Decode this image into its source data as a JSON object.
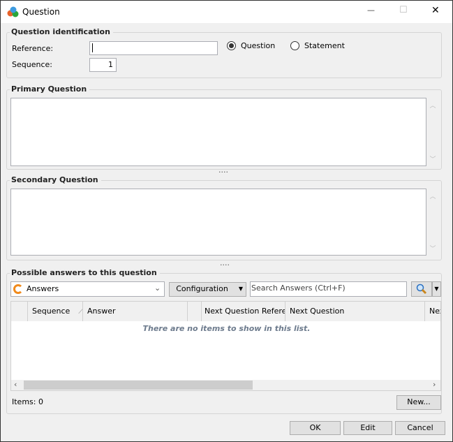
{
  "window": {
    "title": "Question",
    "minimize": "—",
    "maximize": "☐",
    "close": "✕"
  },
  "identification": {
    "title": "Question identification",
    "reference_label": "Reference:",
    "reference_value": "",
    "sequence_label": "Sequence:",
    "sequence_value": "1",
    "radio_question": "Question",
    "radio_statement": "Statement",
    "selected": "Question"
  },
  "primary": {
    "title": "Primary Question",
    "value": ""
  },
  "secondary": {
    "title": "Secondary Question",
    "value": ""
  },
  "splitter": "....",
  "answers": {
    "title": "Possible answers to this question",
    "view_select": "Answers",
    "config_button": "Configuration",
    "search_placeholder": "Search Answers  (Ctrl+F)",
    "columns": [
      "",
      "Sequence",
      "Answer",
      "",
      "Next Question Refere..",
      "Next Question",
      "Nex"
    ],
    "sort_indicator": "1",
    "empty_message": "There are no items to show in this list.",
    "items_count": "Items: 0",
    "new_button": "New..."
  },
  "footer": {
    "ok": "OK",
    "edit": "Edit",
    "cancel": "Cancel"
  }
}
